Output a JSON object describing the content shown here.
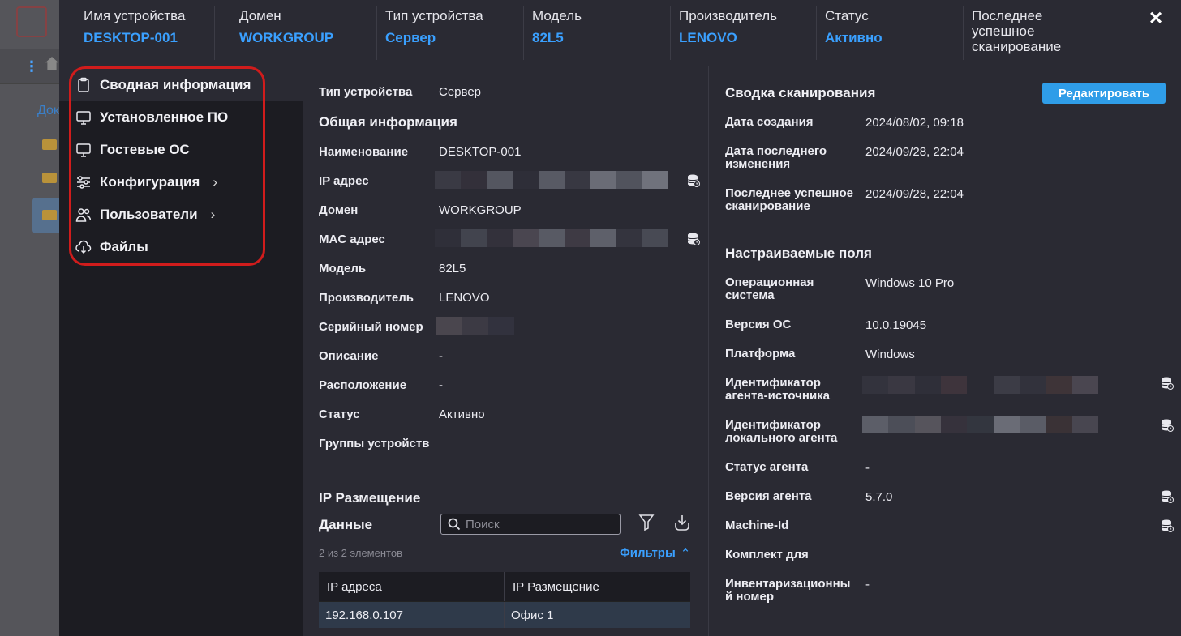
{
  "header": {
    "columns": [
      {
        "label": "Имя устройства",
        "value": "DESKTOP-001"
      },
      {
        "label": "Домен",
        "value": "WORKGROUP"
      },
      {
        "label": "Тип устройства",
        "value": "Сервер"
      },
      {
        "label": "Модель",
        "value": "82L5"
      },
      {
        "label": "Производитель",
        "value": "LENOVO"
      },
      {
        "label": "Статус",
        "value": "Активно"
      },
      {
        "label": "Последнее успешное сканирование",
        "value": ""
      }
    ],
    "close_icon": "×"
  },
  "background": {
    "doc_text": "Док"
  },
  "sidebar": {
    "items": [
      {
        "label": "Сводная информация",
        "icon": "clipboard-icon"
      },
      {
        "label": "Установленное ПО",
        "icon": "monitor-icon"
      },
      {
        "label": "Гостевые ОС",
        "icon": "monitor-icon"
      },
      {
        "label": "Конфигурация",
        "icon": "sliders-icon"
      },
      {
        "label": "Пользователи",
        "icon": "users-icon"
      },
      {
        "label": "Файлы",
        "icon": "cloud-download-icon"
      }
    ]
  },
  "general": {
    "type_label": "Тип устройства",
    "type_value": "Сервер",
    "section_title": "Общая информация",
    "rows": [
      {
        "label": "Наименование",
        "value": "DESKTOP-001"
      },
      {
        "label": "IP адрес",
        "value": ""
      },
      {
        "label": "Домен",
        "value": "WORKGROUP"
      },
      {
        "label": "MAC адрес",
        "value": ""
      },
      {
        "label": "Модель",
        "value": "82L5"
      },
      {
        "label": "Производитель",
        "value": "LENOVO"
      },
      {
        "label": "Серийный номер",
        "value": ""
      },
      {
        "label": "Описание",
        "value": "-"
      },
      {
        "label": "Расположение",
        "value": "-"
      },
      {
        "label": "Статус",
        "value": "Активно"
      },
      {
        "label": "Группы устройств",
        "value": ""
      }
    ]
  },
  "ip_placement": {
    "title": "IP Размещение",
    "data_label": "Данные",
    "search_placeholder": "Поиск",
    "count_text": "2 из 2 элементов",
    "filters_label": "Фильтры",
    "columns": [
      "IP адреса",
      "IP Размещение"
    ],
    "rows": [
      [
        "192.168.0.107",
        "Офис 1"
      ]
    ]
  },
  "scan_summary": {
    "title": "Сводка сканирования",
    "edit_button": "Редактировать",
    "rows": [
      {
        "label": "Дата создания",
        "value": "2024/08/02, 09:18"
      },
      {
        "label": "Дата последнего изменения",
        "value": "2024/09/28, 22:04"
      },
      {
        "label": "Последнее успешное сканирование",
        "value": "2024/09/28, 22:04"
      }
    ]
  },
  "custom_fields": {
    "title": "Настраиваемые поля",
    "rows": [
      {
        "label": "Операционная система",
        "value": "Windows 10 Pro"
      },
      {
        "label": "Версия ОС",
        "value": "10.0.19045"
      },
      {
        "label": "Платформа",
        "value": "Windows"
      },
      {
        "label": "Идентификатор агента-источника",
        "value": ""
      },
      {
        "label": "Идентификатор локального агента",
        "value": ""
      },
      {
        "label": "Статус агента",
        "value": "-"
      },
      {
        "label": "Версия агента",
        "value": "5.7.0"
      },
      {
        "label": "Machine-Id",
        "value": ""
      },
      {
        "label": "Комплект для",
        "value": ""
      },
      {
        "label": "Инвентаризационный номер",
        "value": "-"
      }
    ]
  },
  "colors": {
    "accent": "#3aa0ff",
    "edit_button": "#2f9de8",
    "highlight": "#d01c1c"
  }
}
